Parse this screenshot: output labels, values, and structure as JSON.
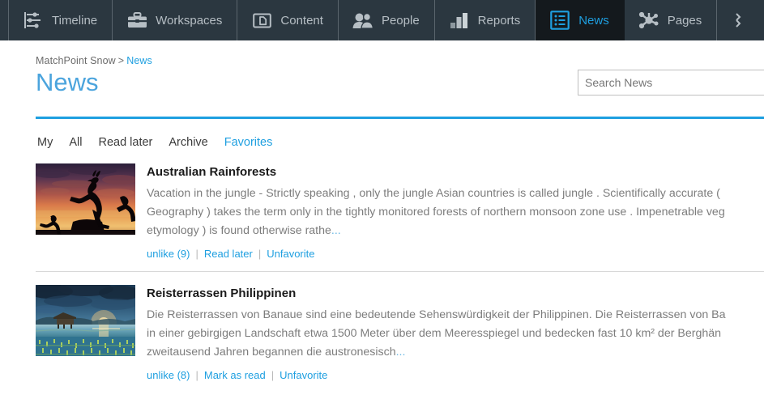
{
  "topnav": {
    "tabs": [
      {
        "label": "Timeline",
        "icon": "timeline-icon",
        "active": false
      },
      {
        "label": "Workspaces",
        "icon": "briefcase-icon",
        "active": false
      },
      {
        "label": "Content",
        "icon": "folder-doc-icon",
        "active": false
      },
      {
        "label": "People",
        "icon": "people-icon",
        "active": false
      },
      {
        "label": "Reports",
        "icon": "bar-chart-icon",
        "active": false
      },
      {
        "label": "News",
        "icon": "list-icon",
        "active": true
      },
      {
        "label": "Pages",
        "icon": "network-icon",
        "active": false
      }
    ],
    "overflow_icon": "more-icon"
  },
  "breadcrumb": {
    "root": "MatchPoint Snow",
    "separator": ">",
    "current": "News"
  },
  "page_title": "News",
  "search": {
    "placeholder": "Search News",
    "value": ""
  },
  "filters": [
    {
      "label": "My",
      "active": false
    },
    {
      "label": "All",
      "active": false
    },
    {
      "label": "Read later",
      "active": false
    },
    {
      "label": "Archive",
      "active": false
    },
    {
      "label": "Favorites",
      "active": true
    }
  ],
  "news": [
    {
      "title": "Australian Rainforests",
      "thumbnail": "kangaroo-sunset-thumbnail",
      "summary_lines": [
        "Vacation in the jungle - Strictly speaking , only the jungle Asian countries is called jungle . Scientifically accurate (",
        "Geography ) takes the term only in the tightly monitored forests of northern monsoon zone use . Impenetrable veg",
        "etymology ) is found otherwise rathe"
      ],
      "more": "...",
      "actions": [
        {
          "label": "unlike (9)",
          "name": "unlike-link"
        },
        {
          "label": "Read later",
          "name": "read-later-link"
        },
        {
          "label": "Unfavorite",
          "name": "unfavorite-link"
        }
      ]
    },
    {
      "title": "Reisterrassen Philippinen",
      "thumbnail": "rice-terraces-thumbnail",
      "summary_lines": [
        "Die Reisterrassen von Banaue sind eine bedeutende Sehenswürdigkeit der Philippinen. Die Reisterrassen von Ba",
        "in einer gebirgigen Landschaft etwa 1500 Meter über dem Meeresspiegel und bedecken fast 10 km² der Berghän",
        "zweitausend Jahren begannen die austronesisch"
      ],
      "more": "...",
      "actions": [
        {
          "label": "unlike (8)",
          "name": "unlike-link"
        },
        {
          "label": "Mark as read",
          "name": "mark-as-read-link"
        },
        {
          "label": "Unfavorite",
          "name": "unfavorite-link"
        }
      ]
    }
  ],
  "colors": {
    "accent": "#1e9fe0",
    "nav_background": "#2b3740",
    "nav_active_background": "#14191d",
    "nav_text": "#b6bec4",
    "title": "#4ba4dd",
    "body_text": "#7d7d7d"
  }
}
